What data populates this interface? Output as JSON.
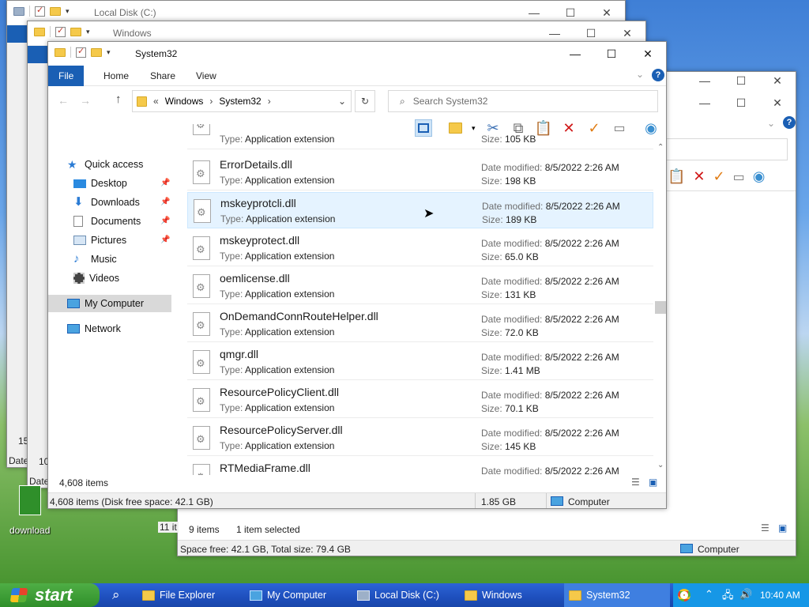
{
  "windows": {
    "local_disk": {
      "title": "Local Disk (C:)"
    },
    "windows_folder": {
      "title": "Windows"
    },
    "system32": {
      "title": "System32",
      "ribbon_tabs": [
        "File",
        "Home",
        "Share",
        "View"
      ],
      "breadcrumb": [
        "«",
        "Windows",
        "System32"
      ],
      "search_placeholder": "Search System32",
      "item_count": "4,608 items",
      "status_bar": {
        "left": "4,608 items (Disk free space: 42.1 GB)",
        "size": "1.85 GB",
        "location": "Computer"
      }
    },
    "back_window": {
      "item_count": "9 items",
      "selected": "1 item selected",
      "status_bar": {
        "left": "Space free: 42.1 GB, Total size: 79.4 GB",
        "location": "Computer"
      }
    }
  },
  "nav": {
    "quick_access": "Quick access",
    "items": [
      "Desktop",
      "Downloads",
      "Documents",
      "Pictures",
      "Music",
      "Videos"
    ],
    "my_computer": "My Computer",
    "network": "Network"
  },
  "files": {
    "type_label": "Type:",
    "date_label": "Date modified:",
    "size_label": "Size:",
    "partial_top": {
      "type": "Application extension",
      "size": "105 KB"
    },
    "rows": [
      {
        "name": "ErrorDetails.dll",
        "type": "Application extension",
        "date": "8/5/2022 2:26 AM",
        "size": "198 KB"
      },
      {
        "name": "mskeyprotcli.dll",
        "type": "Application extension",
        "date": "8/5/2022 2:26 AM",
        "size": "189 KB"
      },
      {
        "name": "mskeyprotect.dll",
        "type": "Application extension",
        "date": "8/5/2022 2:26 AM",
        "size": "65.0 KB"
      },
      {
        "name": "oemlicense.dll",
        "type": "Application extension",
        "date": "8/5/2022 2:26 AM",
        "size": "131 KB"
      },
      {
        "name": "OnDemandConnRouteHelper.dll",
        "type": "Application extension",
        "date": "8/5/2022 2:26 AM",
        "size": "72.0 KB"
      },
      {
        "name": "qmgr.dll",
        "type": "Application extension",
        "date": "8/5/2022 2:26 AM",
        "size": "1.41 MB"
      },
      {
        "name": "ResourcePolicyClient.dll",
        "type": "Application extension",
        "date": "8/5/2022 2:26 AM",
        "size": "70.1 KB"
      },
      {
        "name": "ResourcePolicyServer.dll",
        "type": "Application extension",
        "date": "8/5/2022 2:26 AM",
        "size": "145 KB"
      },
      {
        "name": "RTMediaFrame.dll",
        "date": "8/5/2022 2:26 AM"
      }
    ]
  },
  "desktop": {
    "download_label": "download",
    "left_edge": {
      "n15": "15",
      "n10": "10",
      "date1": "Date",
      "date2": "Date",
      "n11": "11 it"
    }
  },
  "taskbar": {
    "start": "start",
    "items": [
      "File Explorer",
      "My Computer",
      "Local Disk (C:)",
      "Windows",
      "System32"
    ],
    "clock": "10:40 AM"
  },
  "colors": {
    "accent": "#1a5fb4",
    "selection": "#e5f3ff",
    "taskbar": "#1e4fbd",
    "start": "#3a9d33"
  }
}
